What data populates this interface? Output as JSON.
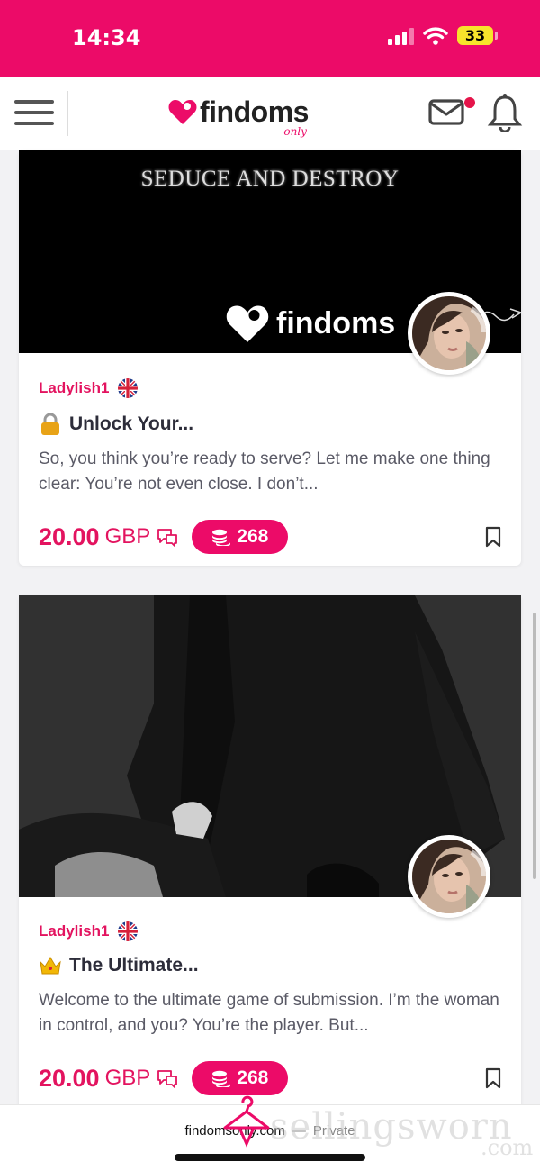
{
  "status_bar": {
    "time": "14:34",
    "battery": "33"
  },
  "header": {
    "logo_text": "findoms",
    "logo_sub": "only"
  },
  "listings": [
    {
      "banner_text": "SEDUCE AND DESTROY",
      "banner_logo": "findoms",
      "seller": "Ladylish1",
      "title": "Unlock Your...",
      "description": "So, you think you’re ready to serve? Let me make one thing clear: You’re not even close. I don’t...",
      "price": "20.00",
      "currency": "GBP",
      "coins": "268"
    },
    {
      "seller": "Ladylish1",
      "title": "The Ultimate...",
      "description": "Welcome to the ultimate game of submission. I’m the woman in control, and you? You’re the player. But...",
      "price": "20.00",
      "currency": "GBP",
      "coins": "268"
    }
  ],
  "browser": {
    "url": "findomsonly.com",
    "separator": "—",
    "mode": "Private"
  },
  "watermark": {
    "text": "sellingsworn",
    "suffix": ".com"
  },
  "colors": {
    "brand": "#ec0b68",
    "price": "#e3135f"
  }
}
